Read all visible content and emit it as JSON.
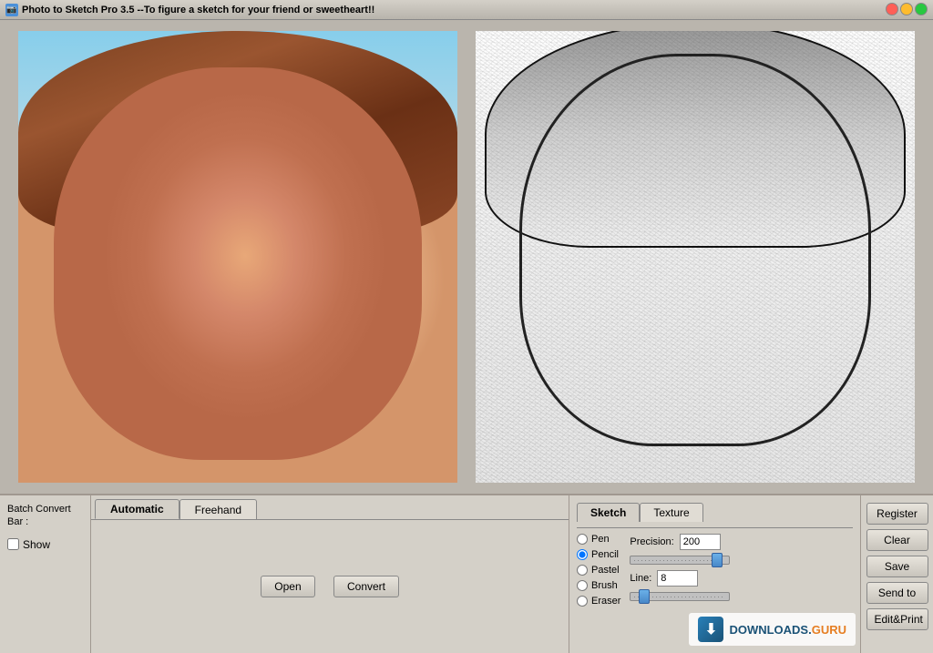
{
  "window": {
    "title": "Photo to Sketch Pro 3.5 --To figure a sketch for your friend or sweetheart!!"
  },
  "tabs": {
    "automatic_label": "Automatic",
    "freehand_label": "Freehand"
  },
  "sketch_tabs": {
    "sketch_label": "Sketch",
    "texture_label": "Texture"
  },
  "controls": {
    "batch_convert_bar": "Batch Convert Bar :",
    "show_label": "Show",
    "open_label": "Open",
    "convert_label": "Convert"
  },
  "radio_options": {
    "pen": "Pen",
    "pencil": "Pencil",
    "pastel": "Pastel",
    "brush": "Brush",
    "eraser": "Eraser"
  },
  "settings": {
    "precision_label": "Precision:",
    "precision_value": "200",
    "line_label": "Line:",
    "line_value": "8"
  },
  "action_buttons": {
    "register": "Register",
    "clear": "Clear",
    "save": "Save",
    "send_to": "Send to",
    "edit_print": "Edit&Print"
  },
  "watermark": {
    "downloads": "DOWNLOADS.",
    "guru": "GURU"
  },
  "slider_precision": {
    "thumb_position": "85%"
  },
  "slider_line": {
    "thumb_position": "10%"
  }
}
